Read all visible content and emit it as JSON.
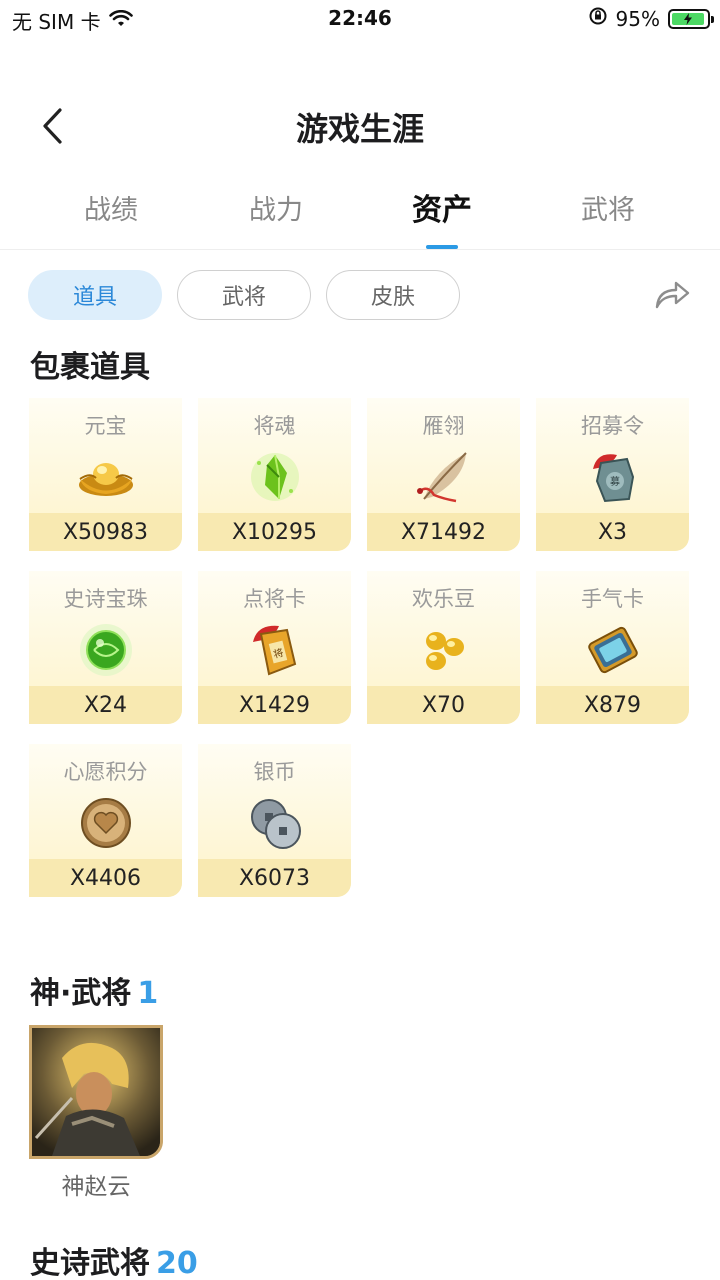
{
  "status_bar": {
    "carrier": "无 SIM 卡",
    "time": "22:46",
    "battery_percent": "95%",
    "battery_level": 0.95,
    "icons": [
      "wifi-icon",
      "orientation-lock-icon",
      "battery-charging-icon"
    ]
  },
  "header": {
    "title": "游戏生涯",
    "back_icon": "chevron-left-icon"
  },
  "main_tabs": [
    {
      "label": "战绩",
      "active": false
    },
    {
      "label": "战力",
      "active": false
    },
    {
      "label": "资产",
      "active": true
    },
    {
      "label": "武将",
      "active": false
    }
  ],
  "sub_tabs": [
    {
      "label": "道具",
      "active": true
    },
    {
      "label": "武将",
      "active": false
    },
    {
      "label": "皮肤",
      "active": false
    }
  ],
  "share_icon": "share-icon",
  "items_section": {
    "title": "包裹道具",
    "items": [
      {
        "name": "元宝",
        "count": "X50983",
        "icon": "gold-ingot-icon"
      },
      {
        "name": "将魂",
        "count": "X10295",
        "icon": "green-crystal-icon"
      },
      {
        "name": "雁翎",
        "count": "X71492",
        "icon": "feather-icon"
      },
      {
        "name": "招募令",
        "count": "X3",
        "icon": "recruit-token-icon"
      },
      {
        "name": "史诗宝珠",
        "count": "X24",
        "icon": "green-orb-icon"
      },
      {
        "name": "点将卡",
        "count": "X1429",
        "icon": "general-card-icon"
      },
      {
        "name": "欢乐豆",
        "count": "X70",
        "icon": "golden-beans-icon"
      },
      {
        "name": "手气卡",
        "count": "X879",
        "icon": "luck-card-icon"
      },
      {
        "name": "心愿积分",
        "count": "X4406",
        "icon": "heart-coin-icon"
      },
      {
        "name": "银币",
        "count": "X6073",
        "icon": "silver-coins-icon"
      }
    ]
  },
  "god_heroes_section": {
    "title": "神·武将",
    "count": "1",
    "heroes": [
      {
        "name": "神赵云",
        "icon": "hero-portrait-icon"
      }
    ]
  },
  "epic_heroes_section": {
    "title": "史诗武将",
    "count": "20"
  },
  "colors": {
    "accent": "#2b9ae5",
    "count_blue": "#3a9ee6",
    "card_top": "#fffdf3",
    "card_bottom": "#fdf3c9",
    "card_footer": "#f8e9b1",
    "active_subtab_bg": "#ddeefb"
  }
}
